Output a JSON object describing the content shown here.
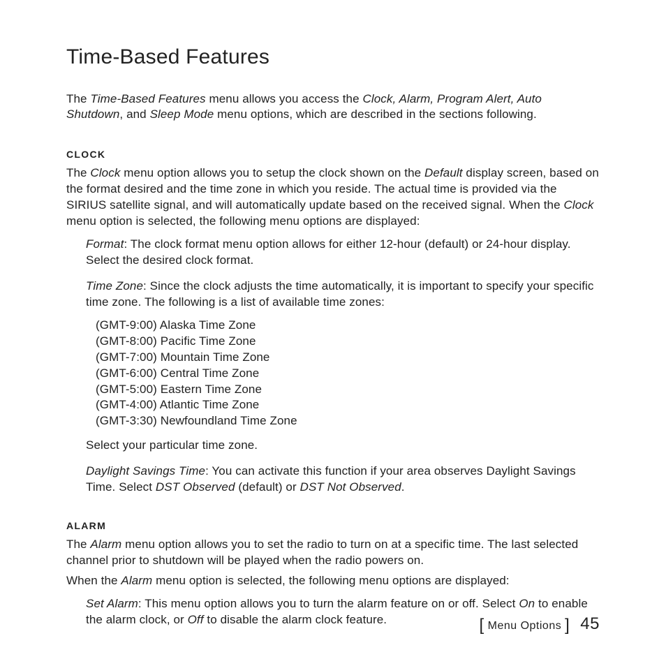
{
  "title": "Time-Based Features",
  "intro": {
    "prefix": "The ",
    "em1": "Time-Based Features",
    "mid1": " menu allows you access the ",
    "em2": "Clock, Alarm, Program Alert, Auto Shutdown",
    "mid2": ", and ",
    "em3": "Sleep Mode",
    "suffix": " menu options, which are described in the sections following."
  },
  "clock": {
    "header": "CLOCK",
    "p1a": "The ",
    "p1em": "Clock",
    "p1b": " menu option allows you to setup the clock shown on the ",
    "p1em2": "Default",
    "p1c": " display screen, based on the format desired and the time zone in which you reside. The actual time is provided via the SIRIUS satellite signal, and will automatically update based on the received signal. When the ",
    "p1em3": "Clock",
    "p1d": " menu option is selected, the following menu options are displayed:",
    "format_em": "Format",
    "format_txt": ": The clock format menu option allows for either 12-hour (default) or 24-hour display. Select the desired clock format.",
    "tz_em": "Time Zone",
    "tz_txt": ": Since the clock adjusts the time automatically, it is important to specify your specific time zone. The following is a list of available time zones:",
    "timezones": [
      "(GMT-9:00) Alaska Time Zone",
      "(GMT-8:00) Pacific Time Zone",
      "(GMT-7:00) Mountain Time Zone",
      "(GMT-6:00) Central Time Zone",
      "(GMT-5:00) Eastern Time Zone",
      "(GMT-4:00) Atlantic Time Zone",
      "(GMT-3:30) Newfoundland Time Zone"
    ],
    "select_txt": "Select your particular time zone.",
    "dst_em": "Daylight Savings Time",
    "dst_a": ": You can activate this function if your area observes Daylight Savings Time. Select ",
    "dst_em2": "DST Observed",
    "dst_b": " (default) or ",
    "dst_em3": "DST Not Observed",
    "dst_c": "."
  },
  "alarm": {
    "header": "ALARM",
    "p1a": "The ",
    "p1em": "Alarm",
    "p1b": " menu option allows you to set the radio to turn on at a specific time. The last selected channel prior to shutdown will be played when the radio powers on.",
    "p2a": "When the ",
    "p2em": "Alarm",
    "p2b": " menu option is selected, the following menu options are displayed:",
    "set_em": "Set Alarm",
    "set_a": ": This menu option allows you to turn the alarm feature on or off. Select ",
    "set_em2": "On",
    "set_b": " to enable the alarm clock, or ",
    "set_em3": "Off",
    "set_c": " to disable the alarm clock feature."
  },
  "footer": {
    "section": "Menu Options",
    "page": "45"
  }
}
